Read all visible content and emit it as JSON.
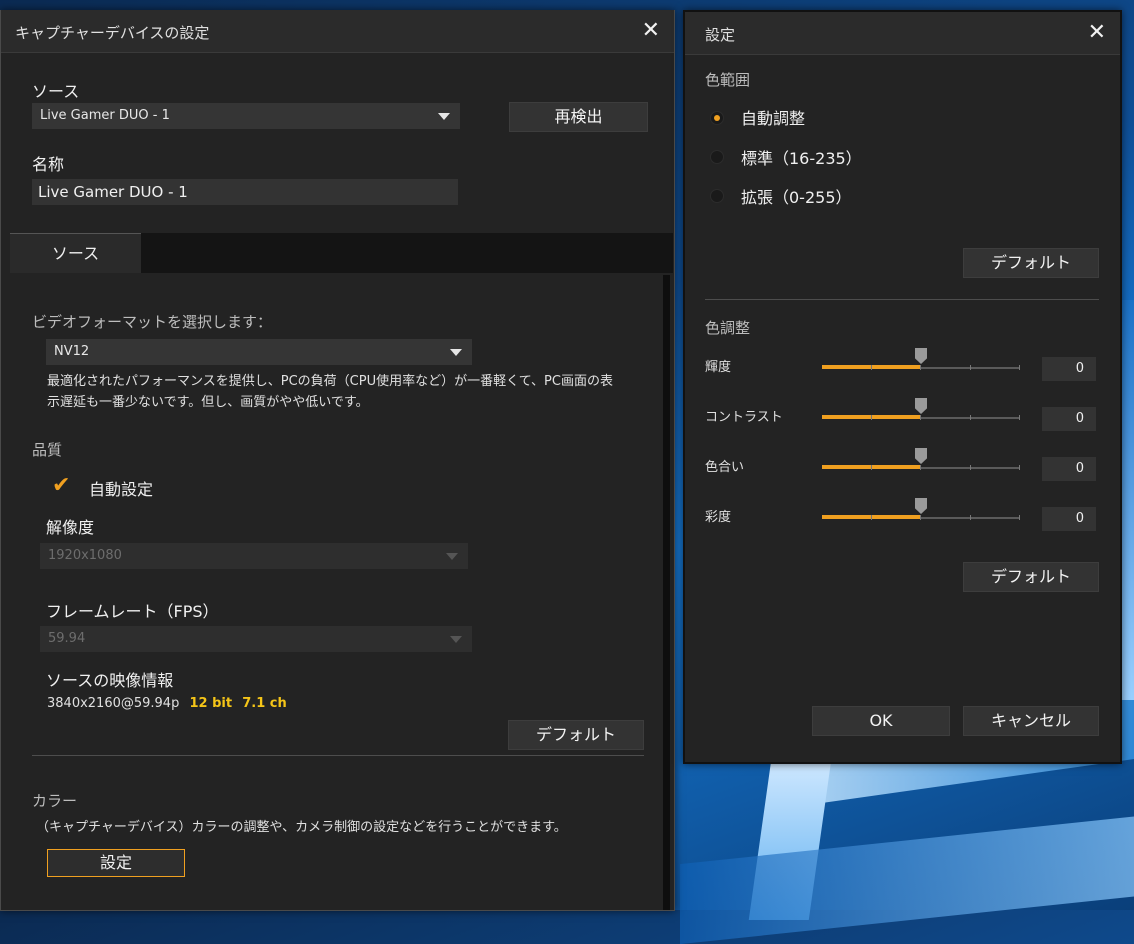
{
  "capture_dialog": {
    "title": "キャプチャーデバイスの設定",
    "source_label": "ソース",
    "source_value": "Live Gamer DUO - 1",
    "redetect_label": "再検出",
    "name_label": "名称",
    "name_value": "Live Gamer DUO - 1",
    "tab_label": "ソース",
    "video_format_label": "ビデオフォーマットを選択します：",
    "video_format_value": "NV12",
    "video_format_desc_1": "最適化されたパフォーマンスを提供し、PCの負荷（CPU使用率など）が一番軽くて、PC画面の表",
    "video_format_desc_2": "示遅延も一番少ないです。但し、画質がやや低いです。",
    "quality_label": "品質",
    "auto_setting_label": "自動設定",
    "resolution_label": "解像度",
    "resolution_value": "1920x1080",
    "framerate_label": "フレームレート（FPS）",
    "framerate_value": "59.94",
    "source_info_label": "ソースの映像情報",
    "source_info_resolution": "3840x2160@59.94p",
    "source_info_bit": "12 bit",
    "source_info_channels": "7.1 ch",
    "default_label": "デフォルト",
    "color_label": "カラー",
    "color_desc": "（キャプチャーデバイス）カラーの調整や、カメラ制御の設定などを行うことができます。",
    "settings_button": "設定"
  },
  "settings_dialog": {
    "title": "設定",
    "color_range_label": "色範囲",
    "range_options": [
      "自動調整",
      "標準（16-235）",
      "拡張（0-255）"
    ],
    "selected_range": 0,
    "default_label_1": "デフォルト",
    "color_adjust_label": "色調整",
    "sliders": [
      {
        "label": "輝度",
        "value": "0",
        "level": 0.5
      },
      {
        "label": "コントラスト",
        "value": "0",
        "level": 0.5
      },
      {
        "label": "色合い",
        "value": "0",
        "level": 0.5
      },
      {
        "label": "彩度",
        "value": "0",
        "level": 0.5
      }
    ],
    "default_label_2": "デフォルト",
    "ok_label": "OK",
    "cancel_label": "キャンセル"
  },
  "colors": {
    "accent": "#f0a020",
    "highlight": "#f5c518"
  }
}
